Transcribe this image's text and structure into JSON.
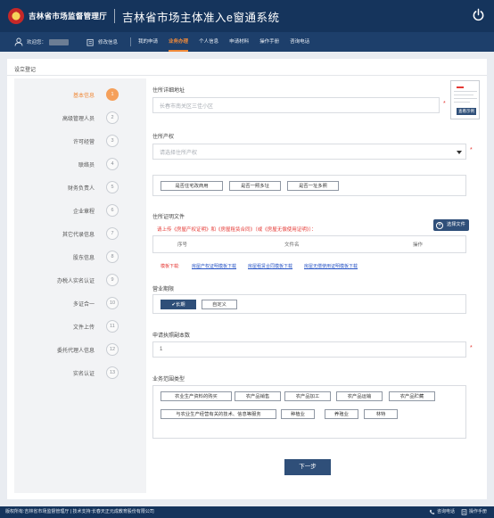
{
  "header": {
    "department": "吉林省市场监督管理厅",
    "system_title": "吉林省市场主体准入e窗通系统"
  },
  "nav": {
    "welcome": "欢迎您：",
    "edit_info": "修改信息",
    "items": [
      "我的申请",
      "业务办理",
      "个人信息",
      "申请材料",
      "操作手册",
      "咨询电话"
    ],
    "active_index": 1
  },
  "panel": {
    "title": "设立登记"
  },
  "steps": [
    {
      "label": "基本信息",
      "num": "1"
    },
    {
      "label": "高级管理人员",
      "num": "2"
    },
    {
      "label": "许可经营",
      "num": "3"
    },
    {
      "label": "联络员",
      "num": "4"
    },
    {
      "label": "财务负责人",
      "num": "5"
    },
    {
      "label": "企业章程",
      "num": "6"
    },
    {
      "label": "其它代录信息",
      "num": "7"
    },
    {
      "label": "股东信息",
      "num": "8"
    },
    {
      "label": "办税人实名认证",
      "num": "9"
    },
    {
      "label": "多证合一",
      "num": "10"
    },
    {
      "label": "文件上传",
      "num": "11"
    },
    {
      "label": "委托代理人信息",
      "num": "12"
    },
    {
      "label": "实名认证",
      "num": "13"
    }
  ],
  "form": {
    "address": {
      "label": "住所详细地址",
      "placeholder": "长春市南关区三佳小区"
    },
    "thumb_button": "查看示例",
    "property": {
      "label": "住所产权",
      "placeholder": "请选择住所产权"
    },
    "property_options": [
      "是否住宅改商用",
      "是否一照多址",
      "是否一址多照"
    ],
    "proof": {
      "label": "住所证明文件",
      "warning": "请上传《房屋产权证明》和《房屋租赁合同》（或《房屋无偿使用证明》）：",
      "upload_button": "选择文件",
      "columns": [
        "序号",
        "文件名",
        "操作"
      ],
      "template_label": "模板下载:",
      "templates": [
        "房屋产权证明模板下载",
        "房屋租赁合同模板下载",
        "房屋无偿使用证明模板下载"
      ]
    },
    "term": {
      "label": "营业期限",
      "long": "✔长期",
      "custom": "自定义"
    },
    "copies": {
      "label": "申请执照副本数",
      "value": "1"
    },
    "scope": {
      "label": "业务范围类型",
      "row1": [
        "农业生产资料的购买",
        "农产品销售",
        "农产品加工",
        "农产品运输",
        "农产品贮藏"
      ],
      "row2": [
        "与农业生产经营有关的技术、信息等服务",
        "种植业",
        "养殖业",
        "林特"
      ]
    },
    "next_button": "下一步"
  },
  "footer": {
    "copyright": "版权所有:吉林省市场监督管理厅 | 技术支持:长春天正元成教育股份有限公司",
    "hotline": "咨询电话",
    "manual": "操作手册"
  },
  "colors": {
    "header": "#15345c",
    "nav": "#1d3f6b",
    "accent": "#f08a3a",
    "primary": "#2f4f79",
    "required": "#e53935"
  },
  "icons": [
    "emblem-logo",
    "power-icon",
    "user-icon",
    "edit-icon",
    "plus-circle-icon",
    "phone-icon",
    "manual-icon",
    "chevron-down-icon"
  ]
}
